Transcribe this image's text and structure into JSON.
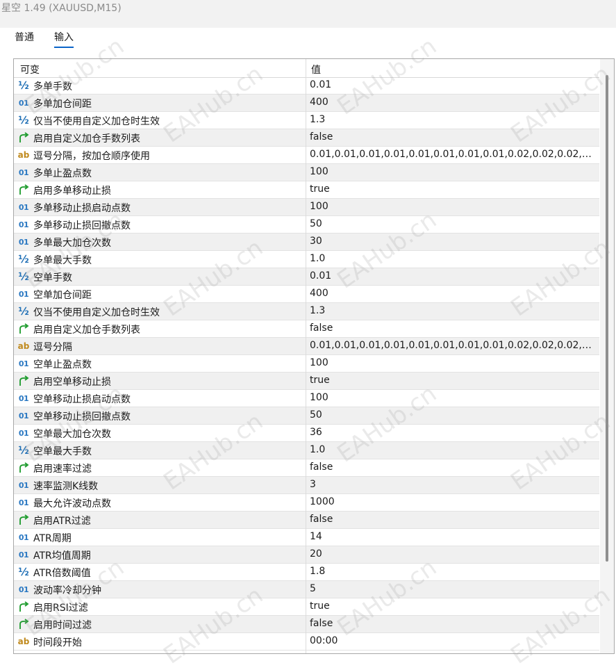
{
  "window": {
    "title": "星空 1.49 (XAUUSD,M15)"
  },
  "tabs": {
    "general": "普通",
    "inputs": "输入"
  },
  "grid": {
    "header": {
      "variable": "可变",
      "value": "值"
    },
    "rows": [
      {
        "icon": "half-icon",
        "name": "多单手数",
        "value": "0.01"
      },
      {
        "icon": "int-icon",
        "name": "多单加仓间距",
        "value": "400"
      },
      {
        "icon": "half-icon",
        "name": "仅当不使用自定义加仓时生效",
        "value": "1.3"
      },
      {
        "icon": "bool-arrow-icon",
        "name": "启用自定义加仓手数列表",
        "value": "false"
      },
      {
        "icon": "string-icon",
        "name": "逗号分隔，按加仓顺序使用",
        "value": "0.01,0.01,0.01,0.01,0.01,0.01,0.01,0.01,0.02,0.02,0.02,0...."
      },
      {
        "icon": "int-icon",
        "name": "多单止盈点数",
        "value": "100"
      },
      {
        "icon": "bool-arrow-icon",
        "name": "启用多单移动止损",
        "value": "true"
      },
      {
        "icon": "int-icon",
        "name": "多单移动止损启动点数",
        "value": "100"
      },
      {
        "icon": "int-icon",
        "name": "多单移动止损回撤点数",
        "value": "50"
      },
      {
        "icon": "int-icon",
        "name": "多单最大加仓次数",
        "value": "30"
      },
      {
        "icon": "half-icon",
        "name": "多单最大手数",
        "value": "1.0"
      },
      {
        "icon": "half-icon",
        "name": "空单手数",
        "value": "0.01"
      },
      {
        "icon": "int-icon",
        "name": "空单加仓间距",
        "value": "400"
      },
      {
        "icon": "half-icon",
        "name": "仅当不使用自定义加仓时生效",
        "value": "1.3"
      },
      {
        "icon": "bool-arrow-icon",
        "name": "启用自定义加仓手数列表",
        "value": "false"
      },
      {
        "icon": "string-icon",
        "name": "逗号分隔",
        "value": "0.01,0.01,0.01,0.01,0.01,0.01,0.01,0.01,0.02,0.02,0.02,0...."
      },
      {
        "icon": "int-icon",
        "name": "空单止盈点数",
        "value": "100"
      },
      {
        "icon": "bool-arrow-icon",
        "name": "启用空单移动止损",
        "value": "true"
      },
      {
        "icon": "int-icon",
        "name": "空单移动止损启动点数",
        "value": "100"
      },
      {
        "icon": "int-icon",
        "name": "空单移动止损回撤点数",
        "value": "50"
      },
      {
        "icon": "int-icon",
        "name": "空单最大加仓次数",
        "value": "36"
      },
      {
        "icon": "half-icon",
        "name": "空单最大手数",
        "value": "1.0"
      },
      {
        "icon": "bool-arrow-icon",
        "name": "启用速率过滤",
        "value": "false"
      },
      {
        "icon": "int-icon",
        "name": "速率监测K线数",
        "value": "3"
      },
      {
        "icon": "int-icon",
        "name": "最大允许波动点数",
        "value": "1000"
      },
      {
        "icon": "bool-arrow-icon",
        "name": "启用ATR过滤",
        "value": "false"
      },
      {
        "icon": "int-icon",
        "name": "ATR周期",
        "value": "14"
      },
      {
        "icon": "int-icon",
        "name": "ATR均值周期",
        "value": "20"
      },
      {
        "icon": "half-icon",
        "name": "ATR倍数阈值",
        "value": "1.8"
      },
      {
        "icon": "int-icon",
        "name": "波动率冷却分钟",
        "value": "5"
      },
      {
        "icon": "bool-arrow-icon",
        "name": "启用RSI过滤",
        "value": "true"
      },
      {
        "icon": "bool-arrow-icon",
        "name": "启用时间过滤",
        "value": "false"
      },
      {
        "icon": "string-icon",
        "name": "时间段开始",
        "value": "00:00"
      }
    ]
  },
  "icon_glyphs": {
    "half-icon": "½",
    "int-icon": "01",
    "string-icon": "ab"
  },
  "colors": {
    "accent": "#0a64c8",
    "bool_icon": "#1a9a2a",
    "int_icon": "#2a78c2",
    "string_icon": "#c08a1e"
  },
  "watermark": "EAHub.cn"
}
